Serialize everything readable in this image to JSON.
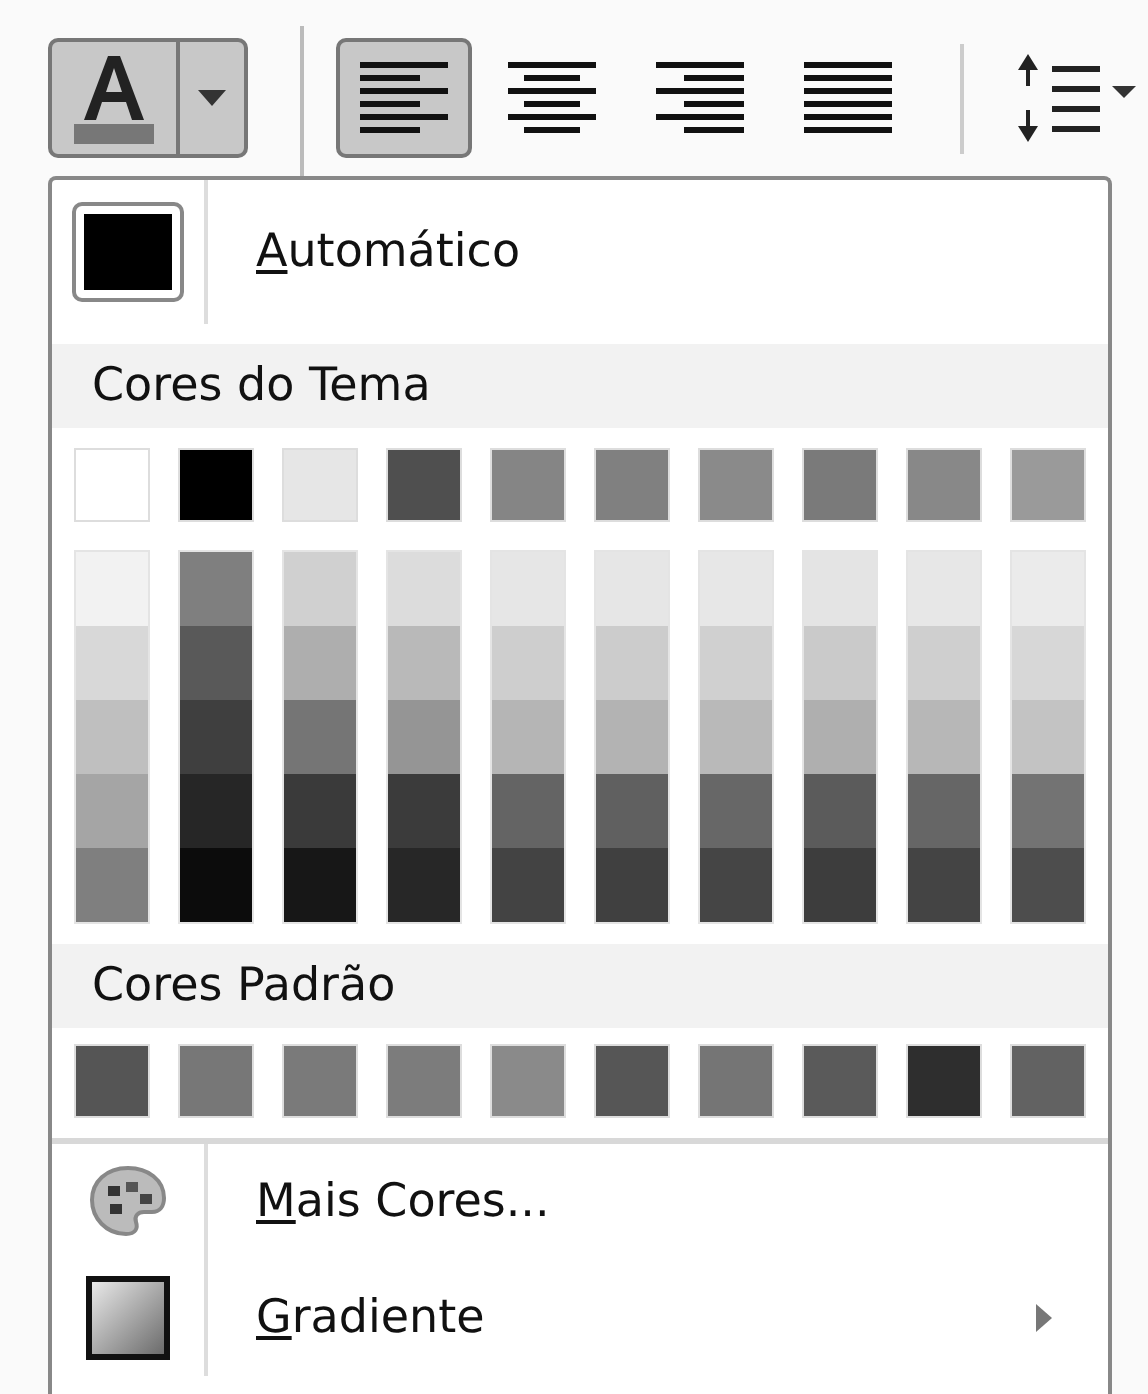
{
  "toolbar": {
    "font_color_button": {
      "expanded": true
    },
    "alignment_buttons": [
      {
        "kind": "left",
        "selected": true
      },
      {
        "kind": "center",
        "selected": false
      },
      {
        "kind": "right",
        "selected": false
      },
      {
        "kind": "justify",
        "selected": false
      }
    ]
  },
  "menu": {
    "automatic": {
      "label": "Automático"
    },
    "theme_heading": "Cores do Tema",
    "theme_colors": [
      {
        "color": "#ffffff",
        "shades": [
          {
            "color": "#f2f2f2"
          },
          {
            "color": "#d8d8d8"
          },
          {
            "color": "#bfbfbf"
          },
          {
            "color": "#a5a5a5"
          },
          {
            "color": "#7f7f7f"
          }
        ]
      },
      {
        "color": "#000000",
        "shades": [
          {
            "color": "#7f7f7f"
          },
          {
            "color": "#595959"
          },
          {
            "color": "#3f3f3f"
          },
          {
            "color": "#262626"
          },
          {
            "color": "#0c0c0c"
          }
        ]
      },
      {
        "color": "#e6e6e6",
        "shades": [
          {
            "color": "#d0d0d0"
          },
          {
            "color": "#aeaeae"
          },
          {
            "color": "#757575"
          },
          {
            "color": "#3a3a3a"
          },
          {
            "color": "#171717"
          }
        ]
      },
      {
        "color": "#4f4f4f",
        "shades": [
          {
            "color": "#dcdcdc"
          },
          {
            "color": "#b9b9b9"
          },
          {
            "color": "#959595"
          },
          {
            "color": "#3b3b3b"
          },
          {
            "color": "#272727"
          }
        ]
      },
      {
        "color": "#858585",
        "shades": [
          {
            "color": "#e6e6e6"
          },
          {
            "color": "#cecece"
          },
          {
            "color": "#b5b5b5"
          },
          {
            "color": "#646464"
          },
          {
            "color": "#434343"
          }
        ]
      },
      {
        "color": "#808080",
        "shades": [
          {
            "color": "#e6e6e6"
          },
          {
            "color": "#cccccc"
          },
          {
            "color": "#b3b3b3"
          },
          {
            "color": "#606060"
          },
          {
            "color": "#404040"
          }
        ]
      },
      {
        "color": "#8a8a8a",
        "shades": [
          {
            "color": "#e7e7e7"
          },
          {
            "color": "#d0d0d0"
          },
          {
            "color": "#b9b9b9"
          },
          {
            "color": "#676767"
          },
          {
            "color": "#454545"
          }
        ]
      },
      {
        "color": "#7a7a7a",
        "shades": [
          {
            "color": "#e4e4e4"
          },
          {
            "color": "#cacaca"
          },
          {
            "color": "#afafaf"
          },
          {
            "color": "#5b5b5b"
          },
          {
            "color": "#3d3d3d"
          }
        ]
      },
      {
        "color": "#888888",
        "shades": [
          {
            "color": "#e7e7e7"
          },
          {
            "color": "#cfcfcf"
          },
          {
            "color": "#b7b7b7"
          },
          {
            "color": "#666666"
          },
          {
            "color": "#444444"
          }
        ]
      },
      {
        "color": "#9a9a9a",
        "shades": [
          {
            "color": "#ebebeb"
          },
          {
            "color": "#d7d7d7"
          },
          {
            "color": "#c3c3c3"
          },
          {
            "color": "#737373"
          },
          {
            "color": "#4d4d4d"
          }
        ]
      }
    ],
    "standard_heading": "Cores Padrão",
    "standard_colors": [
      {
        "color": "#555555"
      },
      {
        "color": "#777777"
      },
      {
        "color": "#7a7a7a"
      },
      {
        "color": "#7c7c7c"
      },
      {
        "color": "#8a8a8a"
      },
      {
        "color": "#565656"
      },
      {
        "color": "#757575"
      },
      {
        "color": "#5a5a5a"
      },
      {
        "color": "#2e2e2e"
      },
      {
        "color": "#626262"
      }
    ],
    "items": [
      {
        "kind": "palette",
        "label": "Mais Cores..."
      },
      {
        "kind": "gradient",
        "label": "Gradiente",
        "submenu": true
      }
    ]
  }
}
